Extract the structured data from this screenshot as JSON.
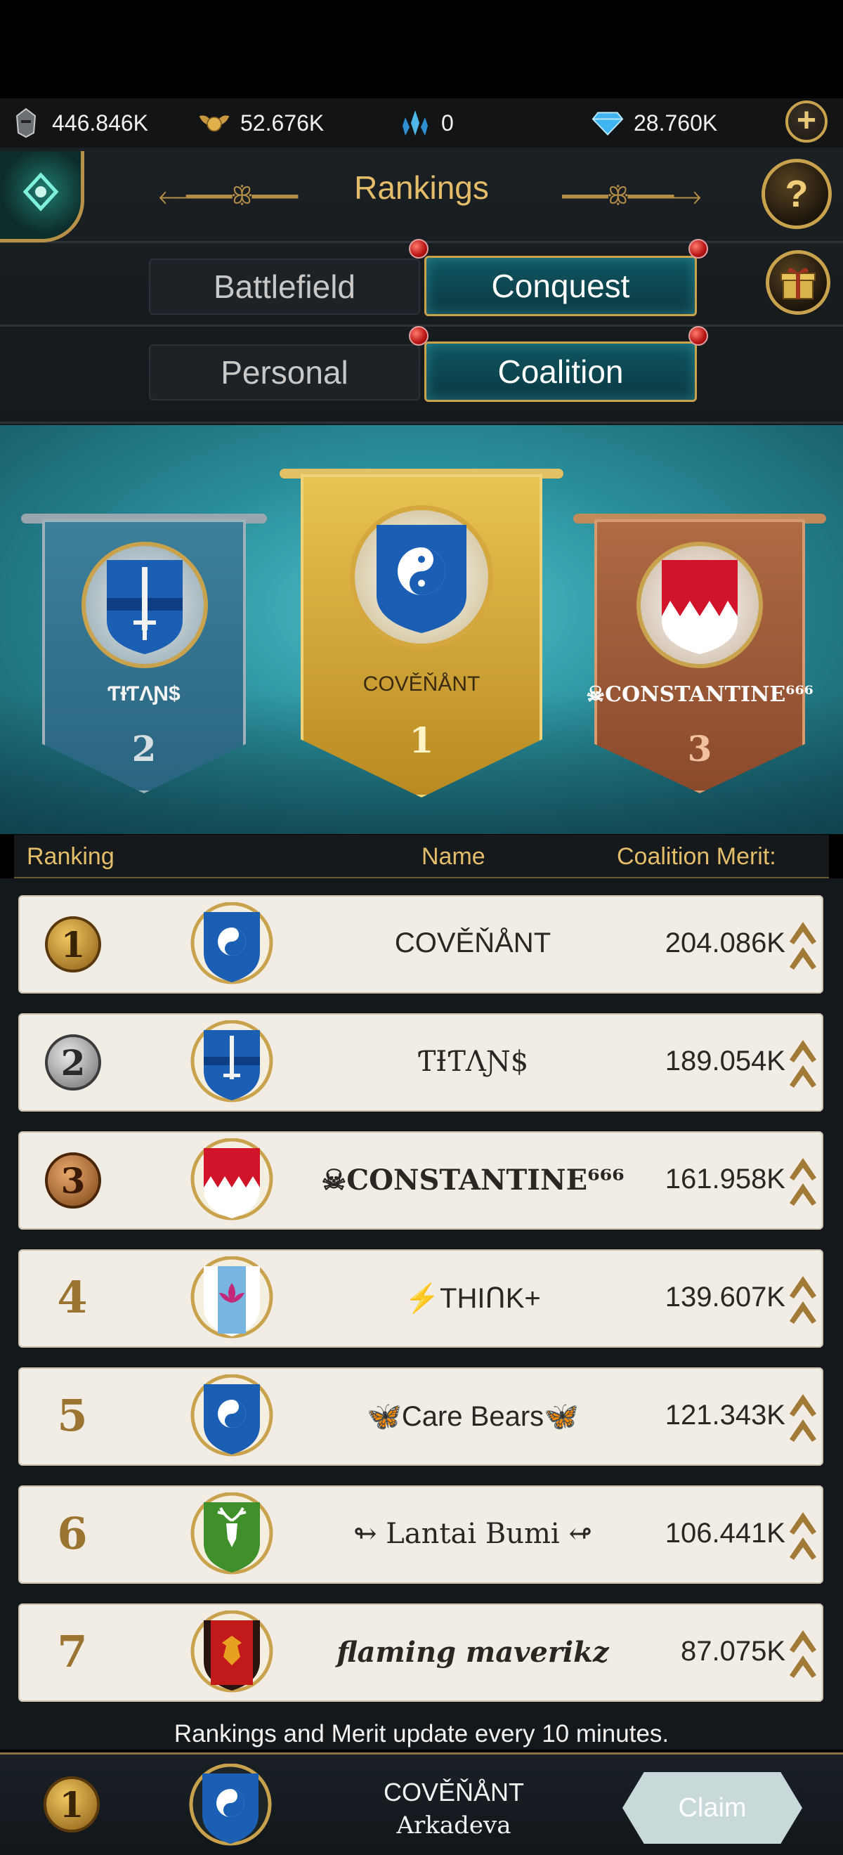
{
  "resources": {
    "troops": "446.846K",
    "honor": "52.676K",
    "crystals": "0",
    "gems": "28.760K"
  },
  "header": {
    "title": "Rankings",
    "help_label": "?"
  },
  "tabs": {
    "mode": [
      "Battlefield",
      "Conquest"
    ],
    "mode_selected": "Conquest",
    "scope": [
      "Personal",
      "Coalition"
    ],
    "scope_selected": "Coalition"
  },
  "podium": {
    "first": {
      "name": "COVĚŇÅNT",
      "rank": "1"
    },
    "second": {
      "name": "ƬƗƬΛƝ$",
      "rank": "2"
    },
    "third": {
      "name": "☠CONSTANTINE⁶⁶⁶",
      "rank": "3"
    }
  },
  "table": {
    "columns": [
      "Ranking",
      "Name",
      "Coalition Merit:"
    ],
    "rows": [
      {
        "rank": "1",
        "name": "COVĚŇÅNT",
        "merit": "204.086K",
        "shield": "yin-yang-shield"
      },
      {
        "rank": "2",
        "name": "ƬƗƬΛƝ$",
        "merit": "189.054K",
        "shield": "sword-shield"
      },
      {
        "rank": "3",
        "name": "☠CONSTANTINE⁶⁶⁶",
        "merit": "161.958K",
        "shield": "red-castle-shield"
      },
      {
        "rank": "4",
        "name": "⚡THIՈK+",
        "merit": "139.607K",
        "shield": "lotus-shield"
      },
      {
        "rank": "5",
        "name": "🦋Care Bears🦋",
        "merit": "121.343K",
        "shield": "yin-yang-shield"
      },
      {
        "rank": "6",
        "name": "↬ Lantai Bumi ↫",
        "merit": "106.441K",
        "shield": "deer-shield"
      },
      {
        "rank": "7",
        "name": "flaming maverikz",
        "merit": "87.075K",
        "shield": "eagle-shield"
      }
    ]
  },
  "footnote": "Rankings and Merit update every 10 minutes.",
  "my_entry": {
    "rank": "1",
    "coalition": "COVĚŇÅNT",
    "player": "Arkadeva",
    "claim_label": "Claim"
  },
  "colors": {
    "gold": "#e4bd6a",
    "teal_active": "#0f5560",
    "row_bg": "#f1ede4"
  }
}
